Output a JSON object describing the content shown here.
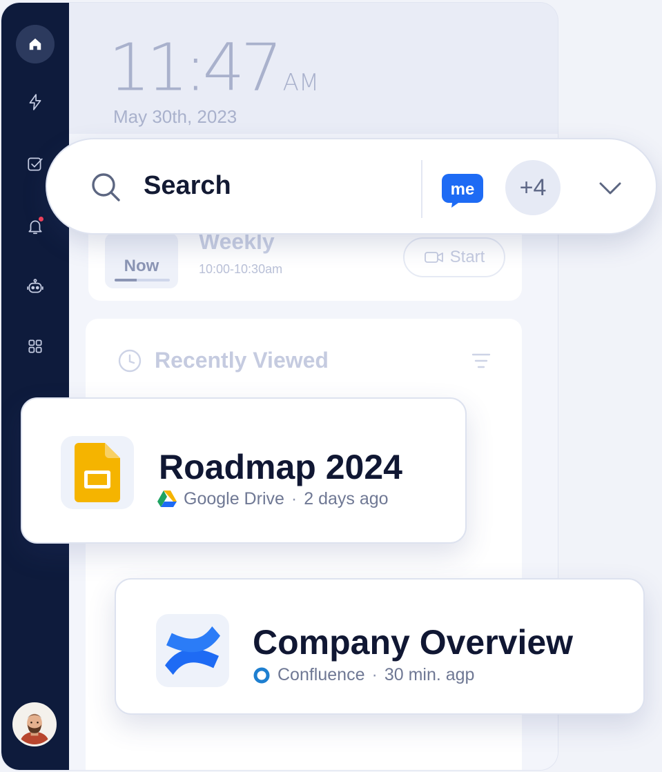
{
  "clock": {
    "time": "11:47",
    "ampm": "AM",
    "date": "May 30th, 2023"
  },
  "sidebar": {
    "items": [
      {
        "icon": "home-icon",
        "active": true
      },
      {
        "icon": "lightning-icon"
      },
      {
        "icon": "checkbox-icon"
      },
      {
        "icon": "bell-icon",
        "has_notification": true
      },
      {
        "icon": "robot-icon"
      },
      {
        "icon": "apps-grid-icon"
      }
    ],
    "user_avatar": "avatar"
  },
  "search": {
    "placeholder": "Search",
    "badge": "me",
    "participant_count": "+4"
  },
  "meeting": {
    "status": "Now",
    "title": "Weekly",
    "time": "10:00-10:30am",
    "start_label": "Start",
    "progress": 0.4
  },
  "recent": {
    "title": "Recently Viewed"
  },
  "files": [
    {
      "title": "Roadmap 2024",
      "source": "Google Drive",
      "separator": "·",
      "time": "2 days ago"
    },
    {
      "title": "Company Overview",
      "source": "Confluence",
      "separator": "·",
      "time": "30 min. agp"
    }
  ],
  "colors": {
    "sidebar_bg": "#0e1b3c",
    "accent_blue": "#1e6bf4",
    "slides_yellow": "#f5b400",
    "text_dark": "#101733"
  }
}
